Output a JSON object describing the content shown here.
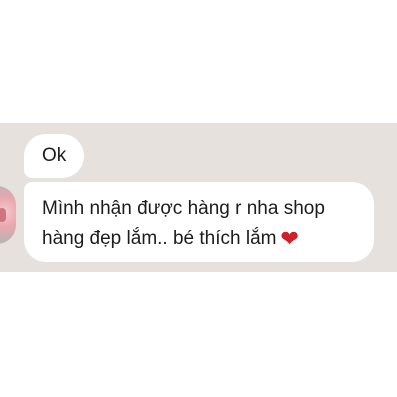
{
  "messages": [
    {
      "text": "Ok"
    },
    {
      "line1": "Mình nhận được hàng r nha shop",
      "line2": "hàng đẹp lắm.. bé thích lắm",
      "emoji": "heart-icon"
    }
  ],
  "colors": {
    "chat_background": "#e6e1dd",
    "bubble": "#ffffff",
    "text": "#1b1b1b",
    "heart": "#d31f2a"
  }
}
